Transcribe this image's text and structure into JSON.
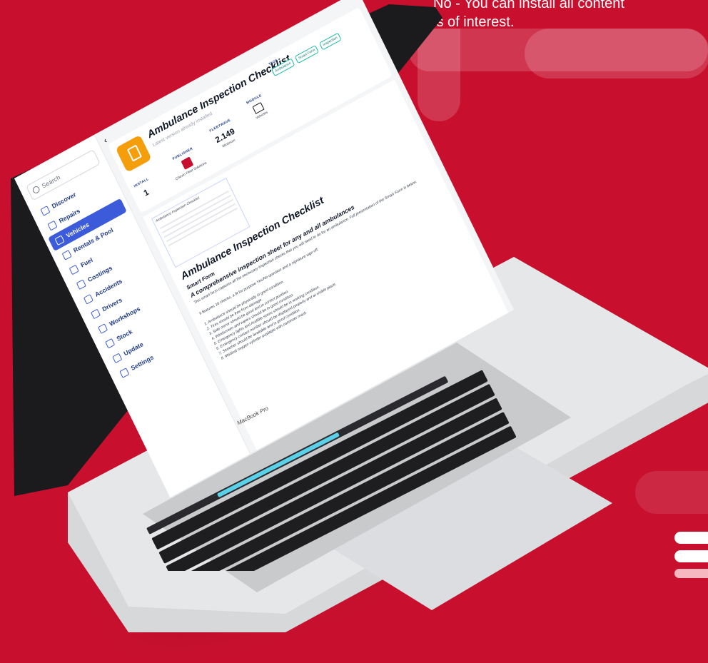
{
  "headline": {
    "line1": "No - You can install all content",
    "line2": "is of interest."
  },
  "colors": {
    "background": "#c8102e",
    "accent": "#3b5bdb",
    "app_icon": "#f59e0b",
    "tag": "#14b8a6"
  },
  "laptop": {
    "brand_text": "MacBook Pro"
  },
  "sidebar": {
    "search_placeholder": "Search",
    "items": [
      {
        "label": "Discover",
        "icon": "star-icon"
      },
      {
        "label": "Repairs",
        "icon": "wrench-icon"
      },
      {
        "label": "Vehicles",
        "icon": "car-icon",
        "active": true
      },
      {
        "label": "Rentals & Pool",
        "icon": "key-icon"
      },
      {
        "label": "Fuel",
        "icon": "fuel-icon"
      },
      {
        "label": "Costings",
        "icon": "money-icon"
      },
      {
        "label": "Accidents",
        "icon": "car-crash-icon"
      },
      {
        "label": "Drivers",
        "icon": "person-icon"
      },
      {
        "label": "Workshops",
        "icon": "building-icon"
      },
      {
        "label": "Stock",
        "icon": "box-icon"
      },
      {
        "label": "Update",
        "icon": "star-icon"
      },
      {
        "label": "Settings",
        "icon": "gear-icon"
      }
    ]
  },
  "header": {
    "title": "Ambulance Inspection Checklist",
    "subtitle": "Latest version already installed",
    "install": {
      "label": "INSTALL",
      "value": "1"
    },
    "publisher": {
      "label": "PUBLISHER",
      "name": "Chevin Fleet Solutions"
    },
    "fleetwave": {
      "label": "FLEETWAVE",
      "value": "2.149",
      "sub": "Minimum"
    },
    "module": {
      "label": "MODULE",
      "value": "Vehicles"
    },
    "tags_label": "TAGS",
    "tags": [
      "Ambulance",
      "Smart Form",
      "Inspection"
    ]
  },
  "preview": {
    "mini_title": "Ambulance Inspection Checklist",
    "heading": "Ambulance Inspection Checklist",
    "type": "Smart Form",
    "summary": "A comprehensive inspection sheet for any and all ambulances",
    "description": "This smart form captures all the necessary inspection checks that you will need to do for an ambulance. Full presentation of the Smart Form is below.",
    "features": "It features 16 checks, a fit for purpose Yes/No question and a signature sign off.",
    "checks": [
      "1. Ambulance should be physically in good condition.",
      "2. Tires should be free from damage.",
      "3. Side mirror should be good and in correct position.",
      "4. Windscreen and wipers should be in good condition.",
      "5. Emergency lights and Audible sirens should be in working condition.",
      "6. Emergency contact number should be displayed properly and at visible place.",
      "7. Stretcher should be available and in good condition.",
      "8. Medical oxygen cylinder available with cannister mask."
    ]
  }
}
